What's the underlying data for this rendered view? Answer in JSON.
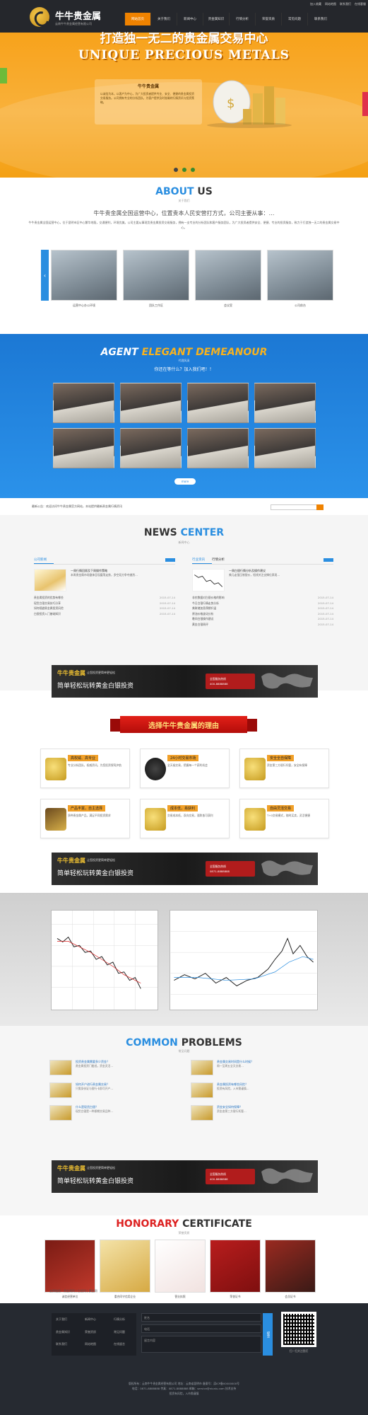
{
  "header": {
    "brand": "牛牛贵金属",
    "tagline": "云南牛牛贵金属经营有限公司",
    "topbar": [
      "加入收藏",
      "网站地图",
      "联系我们",
      "在线客服"
    ],
    "nav": [
      "网站首页",
      "关于我们",
      "新闻中心",
      "贵金属知识",
      "行情分析",
      "荣誉资质",
      "常见问题",
      "联系我们"
    ],
    "active_nav_index": 0
  },
  "banner": {
    "headline": "打造独一无二的贵金属交易中心",
    "headline_en": "UNIQUE PRECIOUS METALS",
    "box_title": "牛牛贵金属",
    "box_text": "以诚信为本，以客户为中心，为广大投资者提供专业、安全、便捷的贵金属投资交易服务。公司拥有专业的分析团队，为客户提供及时准确的行情资讯与投资策略。",
    "slides": 3,
    "current_slide": 1
  },
  "about": {
    "title_a": "ABOUT",
    "title_b": " US",
    "subtitle": "关于我们",
    "lead": "牛牛贵金属全国运营中心，位置贵本人民安营打方式，公司主要从事：…",
    "text": "牛牛贵金属全国运营中心，位于昆明市区中心繁华地段，交通便利，环境优美。公司主要从事现货贵金属投资交易服务，拥有一支专业的分析团队和客户服务团队，为广大投资者提供安全、便捷、专业的投资服务，致力于打造独一无二的贵金属交易中心。",
    "photos": [
      {
        "caption": "运营中心办公环境"
      },
      {
        "caption": "团队工作区"
      },
      {
        "caption": "会议室"
      },
      {
        "caption": "公司前台"
      }
    ]
  },
  "agent": {
    "title_a": "AGENT ",
    "title_b": "ELEGANT DEMEANOUR",
    "subtitle": "代理风采",
    "question": "你还在等什么？加入我们吧！！",
    "button": "more",
    "photo_count": 8
  },
  "notice": {
    "text": "最新公告：欢迎访问牛牛贵金属官方网站，本站提供最新贵金属行情资讯",
    "search_placeholder": "请输入关键词"
  },
  "news": {
    "title_a": "NEWS ",
    "title_b": "CENTER",
    "subtitle": "新闻中心",
    "left": {
      "tab": "公司新闻",
      "feature_title": "一周行情回顾及下周操作策略",
      "feature_text": "本周贵金属市场整体呈现震荡走势，多空双方争夺激烈…",
      "items": [
        {
          "t": "贵金属投资的优势有哪些",
          "d": "2015-07-14"
        },
        {
          "t": "现货白银交易技巧分享",
          "d": "2015-07-14"
        },
        {
          "t": "如何规避贵金属投资风险",
          "d": "2015-07-14"
        },
        {
          "t": "白银投资入门基础知识",
          "d": "2015-07-14"
        }
      ]
    },
    "right": {
      "tabs": [
        "行业资讯",
        "行情分析"
      ],
      "feature_title": "一周白银行情分析及操作建议",
      "feature_text": "美元走强压制银价，短线关注支撑位表现…",
      "items": [
        {
          "t": "非农数据对白银价格的影响",
          "d": "2015-07-14"
        },
        {
          "t": "今日白银行情走势分析",
          "d": "2015-07-14"
        },
        {
          "t": "美联储加息预期升温",
          "d": "2015-07-14"
        },
        {
          "t": "原油价格波动分析",
          "d": "2015-07-14"
        },
        {
          "t": "晚间白银操作建议",
          "d": "2015-07-14"
        },
        {
          "t": "黄金白银周评",
          "d": "2015-07-14"
        }
      ]
    }
  },
  "ad": {
    "brand": "牛牛贵金属",
    "tag": "让您投资更简单更轻松",
    "main": "简单轻松玩转黄金白银投资",
    "phone_label": "全国服务热线",
    "phone1": "400-8888888",
    "phone2": "0871-8888888"
  },
  "reasons": {
    "ribbon": "选择牛牛贵金属的理由",
    "items": [
      {
        "tag": "高权威、高专业",
        "text": "专业分析团队，权威资讯，为您投资保驾护航"
      },
      {
        "tag": "24小时交易市场",
        "text": "全天候交易，把握每一个获利机会"
      },
      {
        "tag": "安全全自保障",
        "text": "资金第三方银行托管，安全有保障"
      },
      {
        "tag": "产品丰富，自主选择",
        "text": "多种贵金属产品，满足不同投资需求"
      },
      {
        "tag": "成本低，易获利",
        "text": "交易成本低，双向交易，涨跌皆可获利"
      },
      {
        "tag": "自由灵活交易",
        "text": "T+0交易模式，随时买卖，灵活便捷"
      }
    ]
  },
  "problems": {
    "title_a": "COMMON ",
    "title_b": "PROBLEMS",
    "subtitle": "常见问题",
    "items": [
      {
        "t": "投资贵金属需要多少资金？",
        "d": "贵金属投资门槛低，资金灵活…"
      },
      {
        "t": "贵金属交易时间是什么时候？",
        "d": "周一至周五全天交易…"
      },
      {
        "t": "如何开户进行贵金属交易？",
        "d": "只需身份证与银行卡即可开户…"
      },
      {
        "t": "贵金属投资有哪些风险？",
        "d": "投资有风险，入市需谨慎…"
      },
      {
        "t": "什么是现货白银？",
        "d": "现货白银是一种即期交易品种…"
      },
      {
        "t": "资金安全如何保障？",
        "d": "资金由第三方银行托管…"
      }
    ]
  },
  "certificates": {
    "title_a": "HONORARY ",
    "title_b": "CERTIFICATE",
    "subtitle": "荣誉资质",
    "items": [
      {
        "caption": "诚信经营单位"
      },
      {
        "caption": "重合同守信用企业"
      },
      {
        "caption": "营业执照"
      },
      {
        "caption": "荣誉证书"
      },
      {
        "caption": "会员证书"
      }
    ]
  },
  "links": "友情链接：贵金属网 | 白银网 | 黄金网",
  "footer": {
    "nav": [
      "关于我们",
      "新闻中心",
      "行情分析",
      "贵金属知识",
      "荣誉资质",
      "常见问题",
      "联系我们",
      "网站地图",
      "在线留言"
    ],
    "form": [
      "姓名",
      "电话",
      "留言内容"
    ],
    "submit": "提交",
    "qr_caption": "扫一扫关注我们",
    "lines": [
      "版权所有：云南牛牛贵金属经营有限公司  地址：云南省昆明市  备案号：滇ICP备00000000号",
      "电话：0871-8888888  传真：0871-8888888  邮箱：service@niuniu.com  技术支持",
      "投资有风险，入市需谨慎"
    ]
  },
  "colors": {
    "accent": "#2a8ee0",
    "orange": "#ef8200",
    "dark": "#25272c"
  }
}
